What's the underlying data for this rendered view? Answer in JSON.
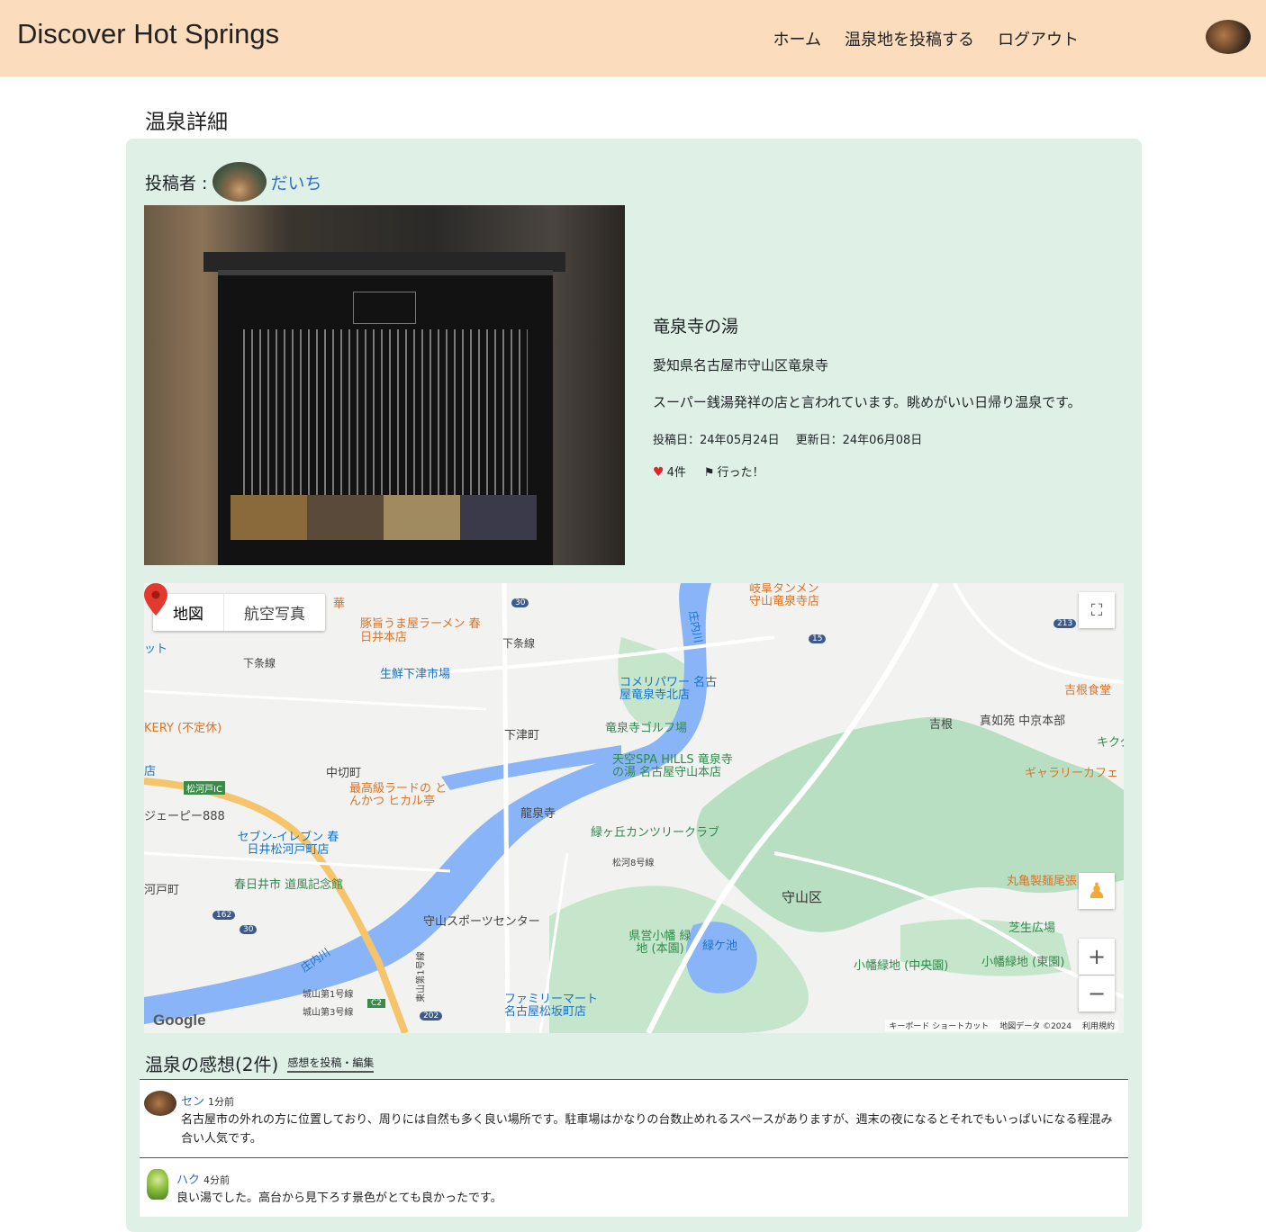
{
  "header": {
    "brand": "Discover Hot Springs",
    "nav": [
      "ホーム",
      "温泉地を投稿する",
      "ログアウト"
    ]
  },
  "page": {
    "title": "温泉詳細"
  },
  "poster": {
    "label": "投稿者 :",
    "name": "だいち"
  },
  "spring": {
    "name": "竜泉寺の湯",
    "address": "愛知県名古屋市守山区竜泉寺",
    "description": "スーパー銭湯発祥の店と言われています。眺めがいい日帰り温泉です。",
    "posted": "投稿日：24年05月24日",
    "updated": "更新日：24年06月08日",
    "likes": "4件",
    "visited": "行った！"
  },
  "map": {
    "type_map": "地図",
    "type_satellite": "航空写真",
    "marker_label": "天空SPA HILLS 竜泉寺の湯 名古屋守山本店",
    "footer_shortcuts": "キーボード ショートカット",
    "footer_data": "地図データ ©2024",
    "footer_terms": "利用規約",
    "labels": {
      "ramen": "豚旨うま屋ラーメン 春日井本店",
      "tanmen": "岐阜タンメン 守山竜泉寺店",
      "market": "生鮮下津市場",
      "komeri": "コメリパワー 名古屋竜泉寺北店",
      "golf": "竜泉寺ゴルフ場",
      "shimozu": "下津町",
      "nakakiri": "中切町",
      "katsu": "最高級ラードの とんかつ ヒカル亭",
      "ryusenji": "龍泉寺",
      "midori": "緑ヶ丘カンツリークラブ",
      "seven": "セブン-イレブン 春日井松河戸町店",
      "michikaze": "春日井市 道風記念館",
      "moriyama": "守山区",
      "sports": "守山スポーツセンター",
      "kenei": "県営小幡 緑地 (本園)",
      "midorigaike": "緑ケ池",
      "obata_central": "小幡緑地 (中央園)",
      "obata_east": "小幡緑地 (東園)",
      "family": "ファミリーマート 名古屋松坂町店",
      "shibafu": "芝生広場",
      "marugame": "丸亀製麺尾張",
      "gallery": "ギャラリーカフェ",
      "yoshine": "吉根",
      "yoshine_food": "吉根食堂",
      "shinnyoen": "真如苑 中京本部",
      "kikuta": "キクタ",
      "shimojosen": "下条線",
      "shimojosen2": "下条線",
      "bakery": "KERY (不定休)",
      "jp888": "ジェーピー888",
      "matsukawado_ic": "松河戸IC",
      "kawadocho": "河戸町",
      "shoten": "店",
      "hua": "華",
      "tto": "ット",
      "r30": "30",
      "r15": "15",
      "r213": "213",
      "r162": "162",
      "r30b": "30",
      "r202": "202",
      "rc2": "C2",
      "shonaigawa": "庄内川",
      "shonaigawa2": "庄内川",
      "matsukawado8": "松河8号線",
      "shiroyama1": "城山第1号線",
      "shiroyama3": "城山第3号線",
      "higashiyama": "東山第1号線"
    }
  },
  "reviews": {
    "title": "温泉の感想(2件)",
    "post_link": "感想を投稿・編集",
    "items": [
      {
        "name": "セン",
        "ago": "1分前",
        "body": "名古屋市の外れの方に位置しており、周りには自然も多く良い場所です。駐車場はかなりの台数止めれるスペースがありますが、週末の夜になるとそれでもいっぱいになる程混み合い人気です。"
      },
      {
        "name": "ハク",
        "ago": "4分前",
        "body": "良い湯でした。高台から見下ろす景色がとても良かったです。"
      }
    ]
  }
}
